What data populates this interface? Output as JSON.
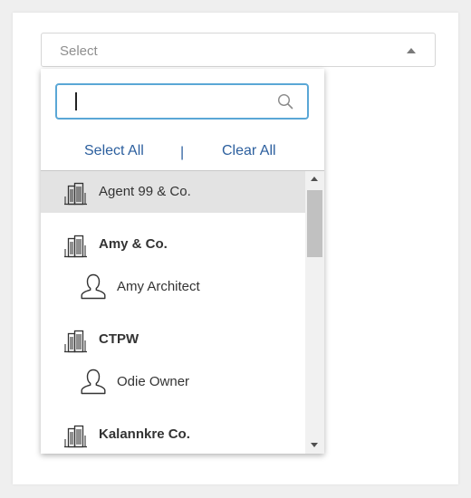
{
  "select": {
    "placeholder": "Select",
    "caret_icon": "caret-up-icon"
  },
  "search": {
    "value": "",
    "placeholder": "",
    "icon": "search-icon"
  },
  "actions": {
    "select_all": "Select All",
    "separator": "|",
    "clear_all": "Clear All"
  },
  "items": [
    {
      "type": "company",
      "label": "Agent 99 & Co.",
      "bold": false,
      "highlighted": true,
      "icon": "building-icon"
    },
    {
      "type": "company",
      "label": "Amy & Co.",
      "bold": true,
      "highlighted": false,
      "icon": "building-icon"
    },
    {
      "type": "person",
      "label": "Amy Architect",
      "highlighted": false,
      "icon": "user-icon"
    },
    {
      "type": "company",
      "label": "CTPW",
      "bold": true,
      "highlighted": false,
      "icon": "building-icon"
    },
    {
      "type": "person",
      "label": "Odie Owner",
      "highlighted": false,
      "icon": "user-icon"
    },
    {
      "type": "company",
      "label": "Kalannkre Co.",
      "bold": true,
      "highlighted": false,
      "icon": "building-icon"
    }
  ],
  "colors": {
    "accent": "#5aa7d6",
    "link": "#2c5f9e",
    "highlight": "#e3e3e3"
  }
}
